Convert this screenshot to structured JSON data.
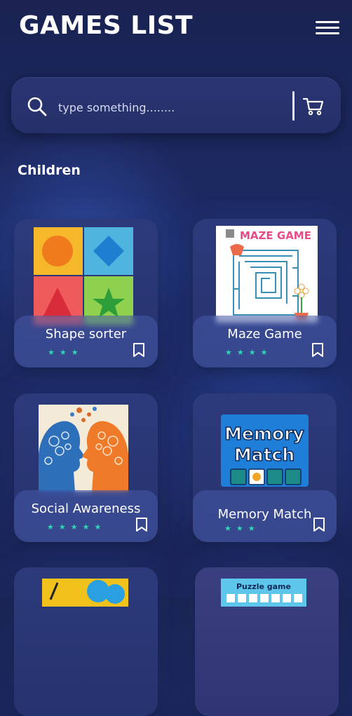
{
  "header": {
    "title": "GAMES LIST"
  },
  "search": {
    "placeholder": "type something........"
  },
  "section": {
    "title": "Children"
  },
  "games": [
    {
      "name": "Shape sorter",
      "stars": "★★★"
    },
    {
      "name": "Maze Game",
      "stars": "★★★★"
    },
    {
      "name": "Social Awareness",
      "stars": "★★★★★"
    },
    {
      "name": "Memory Match",
      "stars": "★★★"
    }
  ],
  "image_text": {
    "maze": "MAZE GAME",
    "memory_line1": "Memory",
    "memory_line2": "Match",
    "puzzle": "Puzzle game"
  },
  "colors": {
    "star": "#2fd6b5",
    "background": "#1c2a66"
  },
  "icons": [
    "menu-icon",
    "search-icon",
    "cart-icon",
    "bookmark-icon"
  ]
}
